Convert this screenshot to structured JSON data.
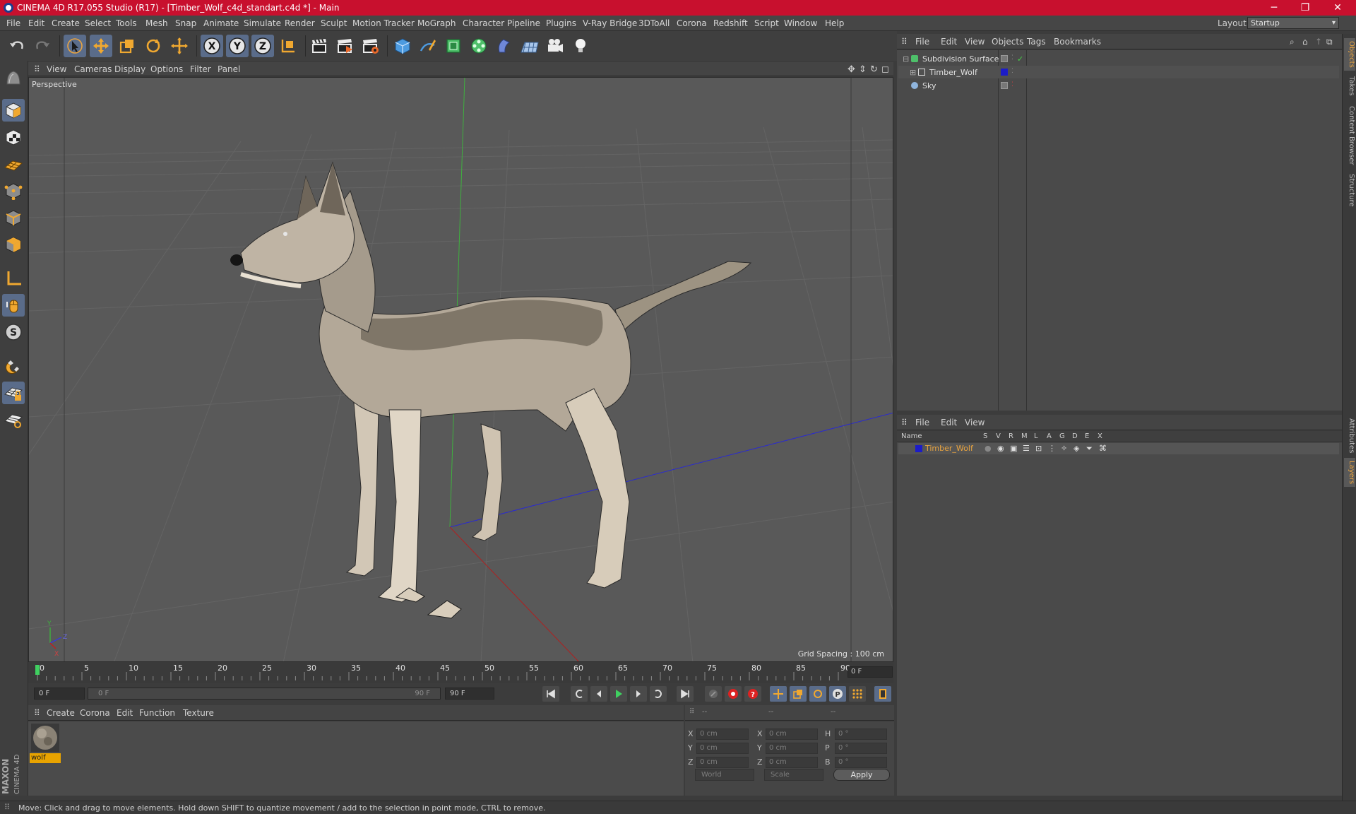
{
  "window": {
    "title": "CINEMA 4D R17.055 Studio (R17) - [Timber_Wolf_c4d_standart.c4d *] - Main",
    "minimize": "─",
    "restore": "❐",
    "close": "✕"
  },
  "menu": [
    "File",
    "Edit",
    "Create",
    "Select",
    "Tools",
    "Mesh",
    "Snap",
    "Animate",
    "Simulate",
    "Render",
    "Sculpt",
    "Motion Tracker",
    "MoGraph",
    "Character",
    "Pipeline",
    "Plugins",
    "V-Ray Bridge",
    "3DToAll",
    "Corona",
    "Redshift",
    "Script",
    "Window",
    "Help"
  ],
  "layout": {
    "label": "Layout:",
    "value": "Startup"
  },
  "viewport": {
    "menu": [
      "View",
      "Cameras",
      "Display",
      "Options",
      "Filter",
      "Panel"
    ],
    "label": "Perspective",
    "grid_spacing": "Grid Spacing : 100 cm",
    "axis_labels": {
      "x": "X",
      "y": "Y",
      "z": "Z"
    }
  },
  "timeline": {
    "ticks": [
      "0",
      "5",
      "10",
      "15",
      "20",
      "25",
      "30",
      "35",
      "40",
      "45",
      "50",
      "55",
      "60",
      "65",
      "70",
      "75",
      "80",
      "85",
      "90"
    ],
    "current_frame": "0 F",
    "start_field": "0 F",
    "range_start": "0 F",
    "range_end": "90 F",
    "end_field": "90 F"
  },
  "material_manager": {
    "menu": [
      "Create",
      "Corona",
      "Edit",
      "Function",
      "Texture"
    ],
    "materials": [
      {
        "name": "wolf"
      }
    ]
  },
  "coordinates": {
    "headers": [
      "--",
      "--",
      "--"
    ],
    "rows": [
      {
        "a": "X",
        "av": "0 cm",
        "b": "X",
        "bv": "0 cm",
        "c": "H",
        "cv": "0 °"
      },
      {
        "a": "Y",
        "av": "0 cm",
        "b": "Y",
        "bv": "0 cm",
        "c": "P",
        "cv": "0 °"
      },
      {
        "a": "Z",
        "av": "0 cm",
        "b": "Z",
        "bv": "0 cm",
        "c": "B",
        "cv": "0 °"
      }
    ],
    "mode": "World",
    "size_mode": "Scale",
    "apply": "Apply"
  },
  "object_manager": {
    "menu": [
      "File",
      "Edit",
      "View",
      "Objects",
      "Tags",
      "Bookmarks"
    ],
    "objects": [
      {
        "name": "Subdivision Surface",
        "layer_color": ""
      },
      {
        "name": "Timber_Wolf",
        "layer_color": "#1c1cc8"
      },
      {
        "name": "Sky",
        "layer_color": ""
      }
    ]
  },
  "layer_manager": {
    "menu": [
      "File",
      "Edit",
      "View"
    ],
    "columns": [
      "Name",
      "S",
      "V",
      "R",
      "M",
      "L",
      "A",
      "G",
      "D",
      "E",
      "X"
    ],
    "layers": [
      {
        "name": "Timber_Wolf",
        "color": "#1c1cc8"
      }
    ]
  },
  "side_tabs": [
    "Objects",
    "Takes",
    "Content Browser",
    "Structure",
    "Attributes",
    "Layers"
  ],
  "status": "Move: Click and drag to move elements. Hold down SHIFT to quantize movement / add to the selection in point mode, CTRL to remove.",
  "brand": "MAXON CINEMA 4D",
  "colors": {
    "accent": "#e8a300",
    "title_bar": "#c8102e",
    "tool_active": "#5a6c8a"
  }
}
